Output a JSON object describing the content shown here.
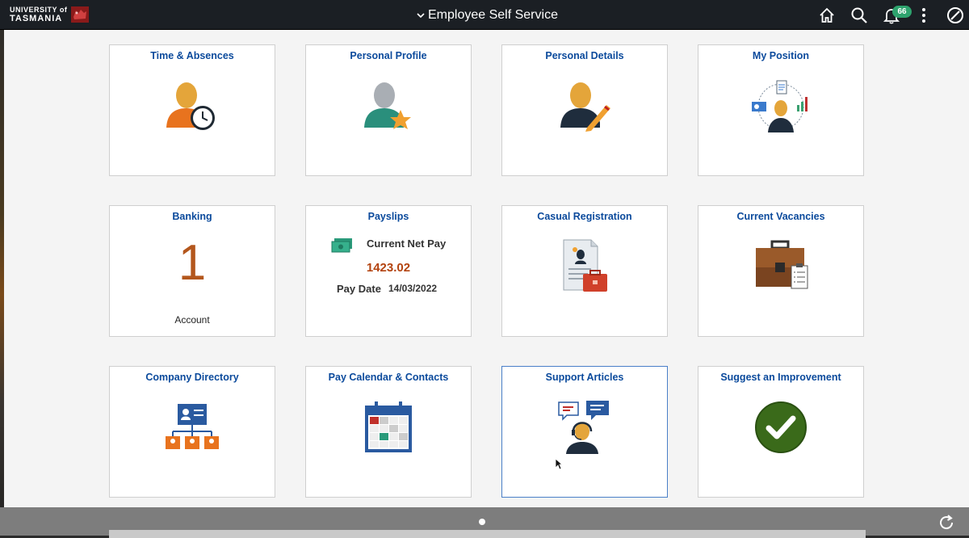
{
  "header": {
    "logo_line1": "UNIVERSITY of",
    "logo_line2": "TASMANIA",
    "title": "Employee Self Service",
    "notification_count": "66",
    "icons": [
      "home-icon",
      "search-icon",
      "bell-icon",
      "more-vert-icon",
      "compass-icon"
    ]
  },
  "tiles": {
    "time_absences": {
      "title": "Time & Absences"
    },
    "personal_profile": {
      "title": "Personal Profile"
    },
    "personal_details": {
      "title": "Personal Details"
    },
    "my_position": {
      "title": "My Position"
    },
    "banking": {
      "title": "Banking",
      "count": "1",
      "label": "Account"
    },
    "payslips": {
      "title": "Payslips",
      "net_pay_label": "Current Net Pay",
      "net_pay_value": "1423.02",
      "pay_date_label": "Pay Date",
      "pay_date_value": "14/03/2022"
    },
    "casual_registration": {
      "title": "Casual Registration"
    },
    "current_vacancies": {
      "title": "Current Vacancies"
    },
    "company_directory": {
      "title": "Company Directory"
    },
    "pay_calendar": {
      "title": "Pay Calendar & Contacts"
    },
    "support_articles": {
      "title": "Support Articles"
    },
    "suggest_improvement": {
      "title": "Suggest an Improvement"
    }
  },
  "footer": {
    "page_indicator": "1 of 1",
    "icons": [
      "refresh-icon"
    ]
  },
  "colors": {
    "header_bg": "#1b1f24",
    "tile_title": "#0b4a9c",
    "badge": "#2ea36e",
    "banking_number": "#b3561c",
    "pay_amount": "#b3430f"
  }
}
